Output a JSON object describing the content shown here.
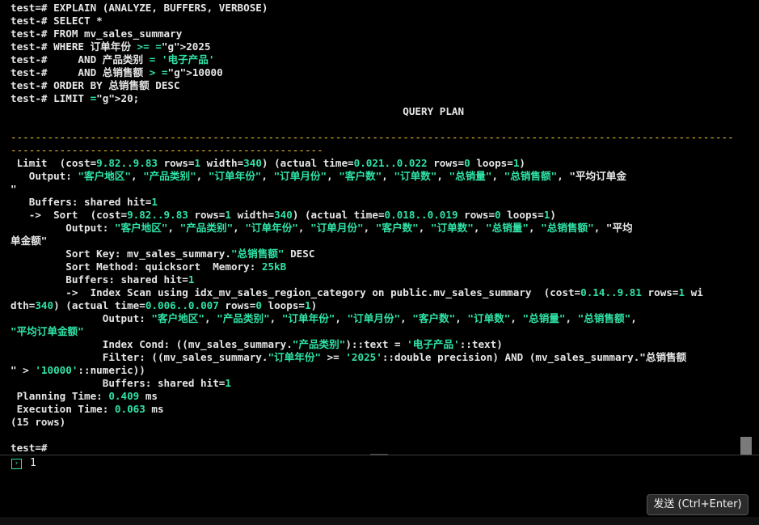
{
  "terminal": {
    "lines": [
      "test=# EXPLAIN (ANALYZE, BUFFERS, VERBOSE)",
      "test-# SELECT *",
      "test-# FROM mv_sales_summary",
      "test-# WHERE 订单年份 >= 2025",
      "test-#     AND 产品类别 = '电子产品'",
      "test-#     AND 总销售额 > 10000",
      "test-# ORDER BY 总销售额 DESC",
      "test-# LIMIT 20;",
      "                                                                QUERY PLAN",
      "",
      "----------------------------------------------------------------------------------------------------------------------",
      "---------------------------------------------------",
      " Limit  (cost=9.82..9.83 rows=1 width=340) (actual time=0.021..0.022 rows=0 loops=1)",
      "   Output: \"客户地区\", \"产品类别\", \"订单年份\", \"订单月份\", \"客户数\", \"订单数\", \"总销量\", \"总销售额\", \"平均订单金",
      "\"",
      "   Buffers: shared hit=1",
      "   ->  Sort  (cost=9.82..9.83 rows=1 width=340) (actual time=0.018..0.019 rows=0 loops=1)",
      "         Output: \"客户地区\", \"产品类别\", \"订单年份\", \"订单月份\", \"客户数\", \"订单数\", \"总销量\", \"总销售额\", \"平均",
      "单金额\"",
      "         Sort Key: mv_sales_summary.\"总销售额\" DESC",
      "         Sort Method: quicksort  Memory: 25kB",
      "         Buffers: shared hit=1",
      "         ->  Index Scan using idx_mv_sales_region_category on public.mv_sales_summary  (cost=0.14..9.81 rows=1 wi",
      "dth=340) (actual time=0.006..0.007 rows=0 loops=1)",
      "               Output: \"客户地区\", \"产品类别\", \"订单年份\", \"订单月份\", \"客户数\", \"订单数\", \"总销量\", \"总销售额\",",
      "\"平均订单金额\"",
      "               Index Cond: ((mv_sales_summary.\"产品类别\")::text = '电子产品'::text)",
      "               Filter: ((mv_sales_summary.\"订单年份\" >= '2025'::double precision) AND (mv_sales_summary.\"总销售额",
      "\" > '10000'::numeric))",
      "               Buffers: shared hit=1",
      " Planning Time: 0.409 ms",
      " Execution Time: 0.063 ms",
      "(15 rows)",
      "",
      "test=#"
    ]
  },
  "input": {
    "prompt_icon": "chevron-right-icon",
    "prompt_glyph": "›",
    "value": "1"
  },
  "send_button": {
    "label": "发送 (Ctrl+Enter)"
  },
  "colors": {
    "background": "#000000",
    "text": "#e6e6e6",
    "number_highlight": "#2fe3a6",
    "separator": "#ffcf33"
  }
}
